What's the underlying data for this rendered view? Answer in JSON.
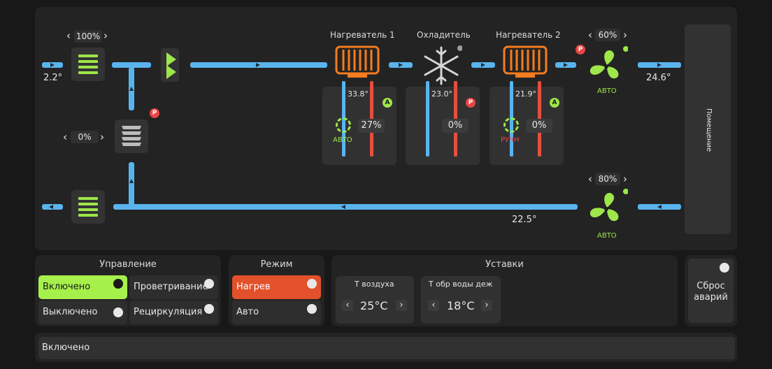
{
  "scheme": {
    "outdoor_temp": "2.2°",
    "supply_temp": "24.6°",
    "return_temp": "22.5°",
    "intake_damper_pct": "100%",
    "recirc_damper_pct": "0%",
    "room_label": "Помещение",
    "heater1": {
      "title": "Нагреватель 1",
      "water_temp": "33.8°",
      "valve_pct": "27%",
      "mode": "АВТО",
      "badge": "A"
    },
    "cooler": {
      "title": "Охладитель",
      "water_temp": "23.0°",
      "valve_pct": "0%",
      "badge": "P"
    },
    "heater2": {
      "title": "Нагреватель 2",
      "water_temp": "21.9°",
      "valve_pct": "0%",
      "mode": "РУЧН",
      "badge": "A"
    },
    "supply_fan": {
      "pct": "60%",
      "mode": "АВТО",
      "badge": "P"
    },
    "exhaust_fan": {
      "pct": "80%",
      "mode": "АВТО"
    },
    "recirc_badge": "P"
  },
  "control": {
    "title": "Управление",
    "on_label": "Включено",
    "off_label": "Выключено",
    "vent_label": "Проветривание",
    "recirc_label": "Рециркуляция"
  },
  "mode": {
    "title": "Режим",
    "heat_label": "Нагрев",
    "auto_label": "Авто"
  },
  "setpoints": {
    "title": "Уставки",
    "air_label": "Т воздуха",
    "air_value": "25°C",
    "water_label": "Т обр воды деж",
    "water_value": "18°C"
  },
  "reset": {
    "label": "Сброс аварий"
  },
  "status": {
    "text": "Включено"
  },
  "colors": {
    "accent_green": "#a6f04c",
    "pipe_blue": "#59b4ee",
    "heat_red": "#e94d3e",
    "heater_orange": "#f57c1f",
    "alarm_red": "#e84545",
    "mode_red": "#e2512b"
  }
}
